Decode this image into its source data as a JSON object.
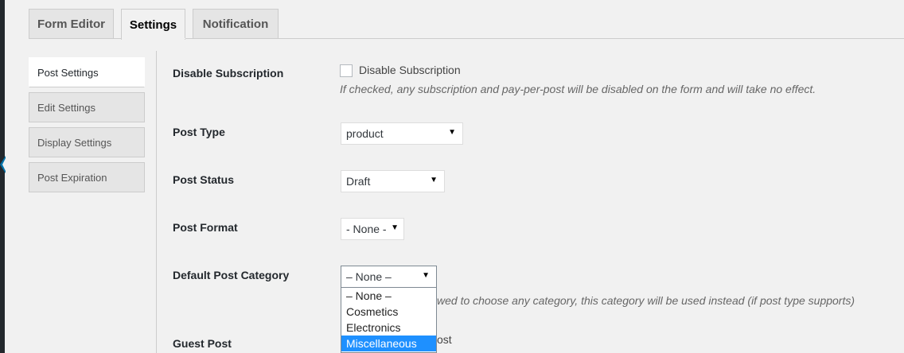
{
  "tabs": [
    {
      "label": "Form Editor"
    },
    {
      "label": "Settings"
    },
    {
      "label": "Notification"
    }
  ],
  "sidenav": [
    {
      "label": "Post Settings"
    },
    {
      "label": "Edit Settings"
    },
    {
      "label": "Display Settings"
    },
    {
      "label": "Post Expiration"
    }
  ],
  "fields": {
    "disable_subscription": {
      "label": "Disable Subscription",
      "checkbox_label": "Disable Subscription",
      "checked": false,
      "description": "If checked, any subscription and pay-per-post will be disabled on the form and will take no effect."
    },
    "post_type": {
      "label": "Post Type",
      "value": "product"
    },
    "post_status": {
      "label": "Post Status",
      "value": "Draft"
    },
    "post_format": {
      "label": "Post Format",
      "value": "- None -"
    },
    "default_post_category": {
      "label": "Default Post Category",
      "value": "– None –",
      "options": [
        "– None –",
        "Cosmetics",
        "Electronics",
        "Miscellaneous"
      ],
      "highlighted": "Miscellaneous",
      "description_visible": "wed to choose any category, this category will be used instead (if post type supports)"
    },
    "guest_post": {
      "label": "Guest Post",
      "visible_tail": "ost"
    }
  },
  "icons": {
    "select_arrow": "▼"
  }
}
